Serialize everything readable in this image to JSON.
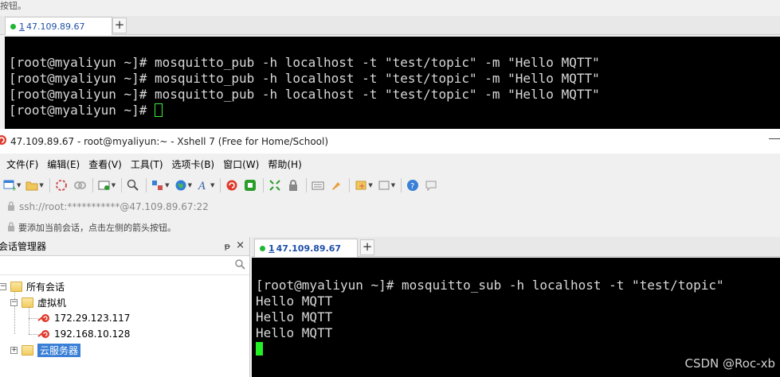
{
  "top_window": {
    "hint": "按钮。",
    "tab": {
      "num": "1",
      "host": "47.109.89.67"
    },
    "terminal_lines": [
      "[root@myaliyun ~]# mosquitto_pub -h localhost -t \"test/topic\" -m \"Hello MQTT\"",
      "[root@myaliyun ~]# mosquitto_pub -h localhost -t \"test/topic\" -m \"Hello MQTT\"",
      "[root@myaliyun ~]# mosquitto_pub -h localhost -t \"test/topic\" -m \"Hello MQTT\"",
      "[root@myaliyun ~]# "
    ]
  },
  "window": {
    "title": "47.109.89.67 - root@myaliyun:~ - Xshell 7 (Free for Home/School)"
  },
  "menu": [
    "文件(F)",
    "编辑(E)",
    "查看(V)",
    "工具(T)",
    "选项卡(B)",
    "窗口(W)",
    "帮助(H)"
  ],
  "address": "ssh://root:***********@47.109.89.67:22",
  "hint": "要添加当前会话，点击左侧的箭头按钮。",
  "session_manager": {
    "title": "会话管理器",
    "pin": "ᵽ",
    "close": "×",
    "tree": {
      "all": "所有会话",
      "vm": "虚拟机",
      "hosts": [
        "172.29.123.117",
        "192.168.10.128"
      ],
      "cloud": "云服务器"
    }
  },
  "main_tab": {
    "num": "1",
    "host": "47.109.89.67"
  },
  "main_terminal_lines": [
    "[root@myaliyun ~]# mosquitto_sub -h localhost -t \"test/topic\"",
    "Hello MQTT",
    "Hello MQTT",
    "Hello MQTT"
  ],
  "watermark": "CSDN @Roc-xb",
  "colors": {
    "tab_dot": "#21b534",
    "cursor": "#22f022",
    "selection": "#3a7fd6",
    "terminal_bg": "#000000"
  }
}
